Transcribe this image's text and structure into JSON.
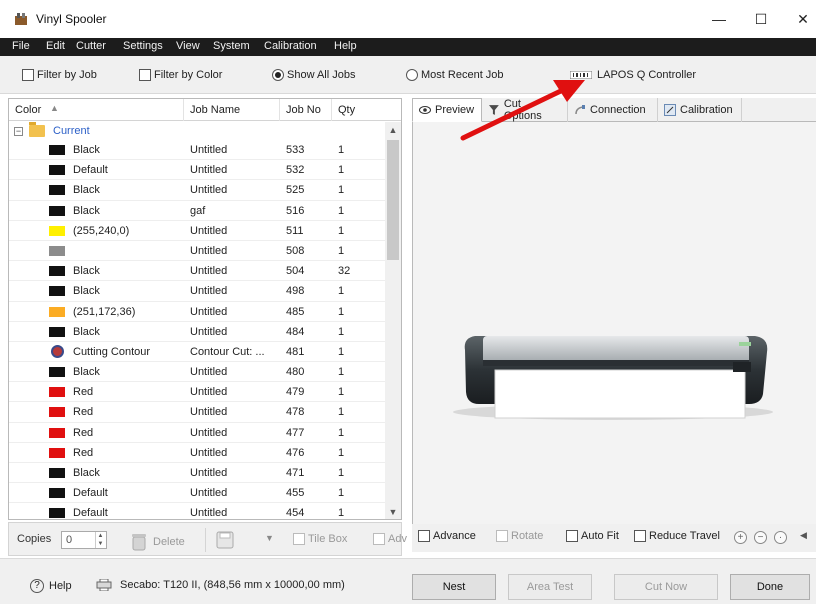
{
  "window": {
    "title": "Vinyl Spooler",
    "minimize": "—",
    "maximize": "☐",
    "close": "✕"
  },
  "menu": [
    "File",
    "Edit",
    "Cutter",
    "Settings",
    "View",
    "System",
    "Calibration",
    "Help"
  ],
  "toolbar": {
    "filter_by_job": "Filter by Job",
    "filter_by_color": "Filter by Color",
    "show_all_jobs": "Show All Jobs",
    "most_recent_job": "Most Recent Job",
    "lapos": "LAPOS Q Controller"
  },
  "table": {
    "headers": [
      "Color",
      "Job Name",
      "Job No",
      "Qty"
    ],
    "group": "Current",
    "rows": [
      {
        "color": "Black",
        "swatch": "#111111",
        "job_name": "Untitled",
        "job_no": "533",
        "qty": "1"
      },
      {
        "color": "Default",
        "swatch": "#111111",
        "job_name": "Untitled",
        "job_no": "532",
        "qty": "1"
      },
      {
        "color": "Black",
        "swatch": "#111111",
        "job_name": "Untitled",
        "job_no": "525",
        "qty": "1"
      },
      {
        "color": "Black",
        "swatch": "#111111",
        "job_name": "gaf",
        "job_no": "516",
        "qty": "1"
      },
      {
        "color": "(255,240,0)",
        "swatch": "#fff000",
        "job_name": "Untitled",
        "job_no": "511",
        "qty": "1"
      },
      {
        "color": "",
        "swatch": "#8c8c8c",
        "job_name": "Untitled",
        "job_no": "508",
        "qty": "1"
      },
      {
        "color": "Black",
        "swatch": "#111111",
        "job_name": "Untitled",
        "job_no": "504",
        "qty": "32"
      },
      {
        "color": "Black",
        "swatch": "#111111",
        "job_name": "Untitled",
        "job_no": "498",
        "qty": "1"
      },
      {
        "color": "(251,172,36)",
        "swatch": "#fbac24",
        "job_name": "Untitled",
        "job_no": "485",
        "qty": "1"
      },
      {
        "color": "Black",
        "swatch": "#111111",
        "job_name": "Untitled",
        "job_no": "484",
        "qty": "1"
      },
      {
        "color": "Cutting Contour",
        "swatch": "contour",
        "job_name": "Contour Cut: ...",
        "job_no": "481",
        "qty": "1"
      },
      {
        "color": "Black",
        "swatch": "#111111",
        "job_name": "Untitled",
        "job_no": "480",
        "qty": "1"
      },
      {
        "color": "Red",
        "swatch": "#e01010",
        "job_name": "Untitled",
        "job_no": "479",
        "qty": "1"
      },
      {
        "color": "Red",
        "swatch": "#e01010",
        "job_name": "Untitled",
        "job_no": "478",
        "qty": "1"
      },
      {
        "color": "Red",
        "swatch": "#e01010",
        "job_name": "Untitled",
        "job_no": "477",
        "qty": "1"
      },
      {
        "color": "Red",
        "swatch": "#e01010",
        "job_name": "Untitled",
        "job_no": "476",
        "qty": "1"
      },
      {
        "color": "Black",
        "swatch": "#111111",
        "job_name": "Untitled",
        "job_no": "471",
        "qty": "1"
      },
      {
        "color": "Default",
        "swatch": "#111111",
        "job_name": "Untitled",
        "job_no": "455",
        "qty": "1"
      },
      {
        "color": "Default",
        "swatch": "#111111",
        "job_name": "Untitled",
        "job_no": "454",
        "qty": "1"
      }
    ]
  },
  "left_bottom": {
    "copies_label": "Copies",
    "copies_value": "0",
    "delete": "Delete",
    "tile_box": "Tile Box",
    "adv": "Adv"
  },
  "tabs": [
    "Preview",
    "Cut Options",
    "Connection",
    "Calibration"
  ],
  "right_bottom": {
    "advance": "Advance",
    "rotate": "Rotate",
    "auto_fit": "Auto Fit",
    "reduce_travel": "Reduce Travel"
  },
  "footer": {
    "help": "Help",
    "status": "Secabo: T120 II,  (848,56 mm x 10000,00 mm)"
  },
  "buttons": {
    "nest": "Nest",
    "area_test": "Area Test",
    "cut_now": "Cut Now",
    "done": "Done"
  },
  "colors": {
    "menubar": "#1c1c1c",
    "link_blue": "#2b5fc7",
    "annotation_arrow": "#e01010"
  }
}
